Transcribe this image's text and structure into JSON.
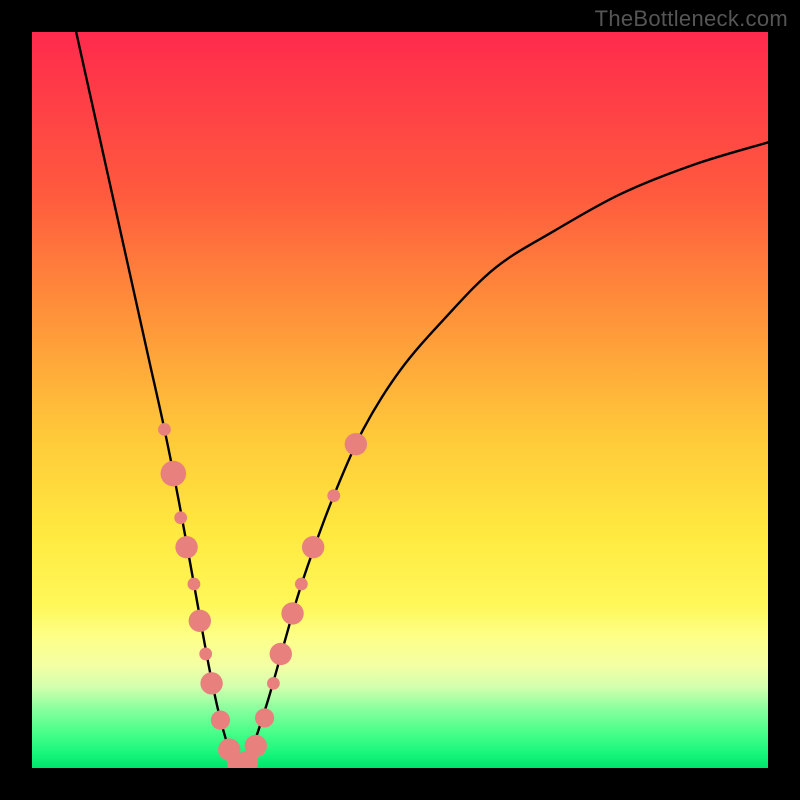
{
  "watermark": "TheBottleneck.com",
  "chart_data": {
    "type": "line",
    "title": "",
    "xlabel": "",
    "ylabel": "",
    "xlim": [
      0,
      100
    ],
    "ylim": [
      0,
      100
    ],
    "series": [
      {
        "name": "left-curve",
        "x": [
          6,
          8,
          10,
          12,
          14,
          16,
          18,
          20,
          22,
          24,
          25.5,
          27,
          28.3
        ],
        "y": [
          100,
          91,
          82,
          73,
          64,
          55,
          46,
          36,
          25,
          14,
          7,
          2,
          0
        ]
      },
      {
        "name": "right-curve",
        "x": [
          28.3,
          30,
          32,
          34,
          36,
          38,
          41,
          45,
          50,
          56,
          63,
          71,
          80,
          90,
          100
        ],
        "y": [
          0,
          3,
          9,
          16,
          23,
          29,
          37,
          46,
          54,
          61,
          68,
          73,
          78,
          82,
          85
        ]
      }
    ],
    "highlights": [
      {
        "series": "left-curve",
        "x": 18.0,
        "y": 46.0,
        "r": 2.0
      },
      {
        "series": "left-curve",
        "x": 19.2,
        "y": 40.0,
        "r": 4.0
      },
      {
        "series": "left-curve",
        "x": 20.2,
        "y": 34.0,
        "r": 2.0
      },
      {
        "series": "left-curve",
        "x": 21.0,
        "y": 30.0,
        "r": 3.5
      },
      {
        "series": "left-curve",
        "x": 22.0,
        "y": 25.0,
        "r": 2.0
      },
      {
        "series": "left-curve",
        "x": 22.8,
        "y": 20.0,
        "r": 3.5
      },
      {
        "series": "left-curve",
        "x": 23.6,
        "y": 15.5,
        "r": 2.0
      },
      {
        "series": "left-curve",
        "x": 24.4,
        "y": 11.5,
        "r": 3.5
      },
      {
        "series": "left-curve",
        "x": 25.6,
        "y": 6.5,
        "r": 3.0
      },
      {
        "series": "left-curve",
        "x": 26.8,
        "y": 2.5,
        "r": 3.5
      },
      {
        "series": "left-curve",
        "x": 28.0,
        "y": 0.6,
        "r": 3.5
      },
      {
        "series": "right-curve",
        "x": 29.2,
        "y": 0.8,
        "r": 3.5
      },
      {
        "series": "right-curve",
        "x": 30.4,
        "y": 3.0,
        "r": 3.5
      },
      {
        "series": "right-curve",
        "x": 31.6,
        "y": 6.8,
        "r": 3.0
      },
      {
        "series": "right-curve",
        "x": 32.8,
        "y": 11.5,
        "r": 2.0
      },
      {
        "series": "right-curve",
        "x": 33.8,
        "y": 15.5,
        "r": 3.5
      },
      {
        "series": "right-curve",
        "x": 35.4,
        "y": 21.0,
        "r": 3.5
      },
      {
        "series": "right-curve",
        "x": 36.6,
        "y": 25.0,
        "r": 2.0
      },
      {
        "series": "right-curve",
        "x": 38.2,
        "y": 30.0,
        "r": 3.5
      },
      {
        "series": "right-curve",
        "x": 41.0,
        "y": 37.0,
        "r": 2.0
      },
      {
        "series": "right-curve",
        "x": 44.0,
        "y": 44.0,
        "r": 3.5
      }
    ],
    "colors": {
      "curve": "#000000",
      "highlight_fill": "#e8817d",
      "highlight_stroke": "#d86b66"
    }
  }
}
